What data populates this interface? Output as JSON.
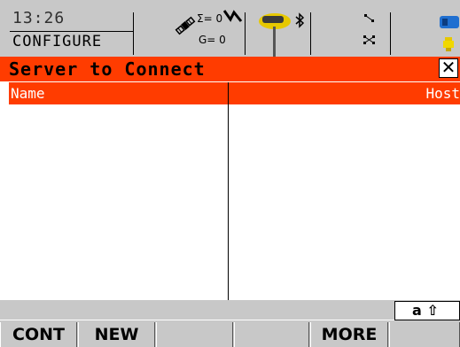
{
  "status": {
    "time": "13:26",
    "mode": "CONFIGURE",
    "sigma_value": "Σ= 0",
    "g_value": "G= 0"
  },
  "window": {
    "title": "Server to Connect",
    "close_symbol": "✕"
  },
  "table": {
    "columns": [
      "Name",
      "Host"
    ],
    "rows": []
  },
  "input_mode": {
    "label": "a ⇧"
  },
  "softkeys": [
    "CONT",
    "NEW",
    "",
    "",
    "MORE",
    ""
  ],
  "icons": {
    "satellite": "satellite-icon",
    "link": "link-icon",
    "antenna": "gps-antenna-icon",
    "bluetooth": "bluetooth-icon",
    "network": "network-icon",
    "battery": "battery-icon"
  },
  "colors": {
    "accent": "#ff3c00",
    "bar_gray": "#c8c8c8"
  }
}
